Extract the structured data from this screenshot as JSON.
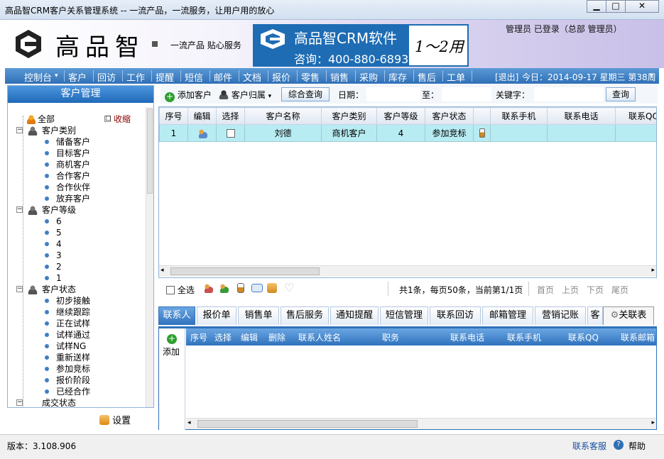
{
  "window": {
    "title": "高品智CRM客户关系管理系统 -- 一流产品，一流服务，让用户用的放心",
    "controls": [
      "▁",
      "□",
      "✕"
    ]
  },
  "banner": {
    "logo_text": "高品智",
    "slogan": "一流产品 贴心服务",
    "ad_title": "高品智CRM软件",
    "ad_phone": "咨询：400-880-6893",
    "ad_right": "1～2用",
    "login_status": "管理员  已登录（总部  管理员）"
  },
  "menu": {
    "items": [
      "控制台",
      "客户",
      "回访",
      "工作",
      "提醒",
      "短信",
      "邮件",
      "文档",
      "报价",
      "零售",
      "销售",
      "采购",
      "库存",
      "售后",
      "工单"
    ],
    "dropdown_marker": "▾",
    "logout": "[退出]",
    "date": "今日：2014-09-17 星期三 第38周"
  },
  "left": {
    "header": "客户管理",
    "collapse": "收缩",
    "collapse_box": "□",
    "all": "全部",
    "groups": [
      {
        "label": "客户类别",
        "items": [
          "储备客户",
          "目标客户",
          "商机客户",
          "合作客户",
          "合作伙伴",
          "放弃客户"
        ]
      },
      {
        "label": "客户等级",
        "items": [
          "6",
          "5",
          "4",
          "3",
          "2",
          "1"
        ]
      },
      {
        "label": "客户状态",
        "items": [
          "初步接触",
          "继续跟踪",
          "正在试样",
          "试样通过",
          "试样NG",
          "重新送样",
          "参加竞标",
          "报价阶段",
          "已经合作"
        ]
      }
    ],
    "truncated_next": "成交状态",
    "settings": "设置"
  },
  "toolbar": {
    "add_customer": "添加客户",
    "customer_assign": "客户归属",
    "advanced_search": "综合查询",
    "date_label": "日期：",
    "to_label": "至：",
    "keyword_label": "关键字：",
    "search_button": "查询"
  },
  "grid": {
    "columns": [
      "序号",
      "编辑",
      "选择",
      "客户名称",
      "客户类别",
      "客户等级",
      "客户状态",
      "",
      "联系手机",
      "联系电话",
      "联系QQ"
    ],
    "rows": [
      {
        "index": "1",
        "name": "刘德",
        "category": "商机客户",
        "level": "4",
        "status": "参加竞标",
        "mobile": "",
        "phone": "",
        "qq": ""
      }
    ]
  },
  "pager": {
    "select_all": "全选",
    "summary": "共1条，每页50条，当前第1/1页",
    "first": "首页",
    "prev": "上页",
    "next": "下页",
    "last": "尾页"
  },
  "tabs": {
    "items": [
      "联系人",
      "报价单",
      "销售单",
      "售后服务",
      "通知提醒",
      "短信管理",
      "联系回访",
      "邮箱管理",
      "营销记账",
      "客"
    ],
    "active_index": 0,
    "close_related": "关联表"
  },
  "contacts": {
    "add": "添加",
    "columns": [
      "序号",
      "选择",
      "编辑",
      "删除",
      "联系人姓名",
      "职务",
      "联系电话",
      "联系手机",
      "联系QQ",
      "联系邮箱"
    ]
  },
  "status": {
    "version": "版本：3.108.906",
    "contact_service": "联系客服",
    "help": "帮助"
  },
  "colors": {
    "menu_blue": "#2f6fb6",
    "row_highlight": "#b8ecf3",
    "active_tab": "#2f72bd",
    "link_blue": "#1a4fa0"
  }
}
